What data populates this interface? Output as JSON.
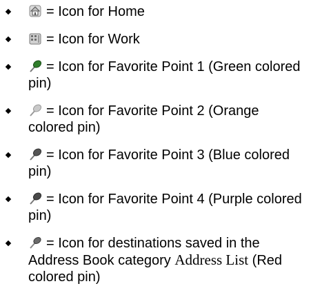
{
  "legend": {
    "items": [
      {
        "icon": "home-icon",
        "eq": "=",
        "text": "Icon for Home"
      },
      {
        "icon": "work-icon",
        "eq": "=",
        "text": "Icon for Work"
      },
      {
        "icon": "green-pin-icon",
        "color": "#2f7d2a",
        "eq": "=",
        "text": "Icon for Favorite Point 1 (Green colored pin)"
      },
      {
        "icon": "orange-pin-icon",
        "color": "#e08a1e",
        "eq": "=",
        "text": "Icon for Favorite Point 2 (Orange colored pin)"
      },
      {
        "icon": "blue-pin-icon",
        "color": "#2a4fb0",
        "eq": "=",
        "text": "Icon for Favorite Point 3 (Blue colored pin)"
      },
      {
        "icon": "purple-pin-icon",
        "color": "#7a2f8f",
        "eq": "=",
        "text": "Icon for Favorite Point 4 (Purple colored pin)"
      },
      {
        "icon": "red-pin-icon",
        "color": "#c42121",
        "eq": "=",
        "text_before": "Icon for destinations saved in the Address Book category",
        "text_serif": "Address List",
        "text_after": "(Red colored pin)"
      }
    ]
  }
}
